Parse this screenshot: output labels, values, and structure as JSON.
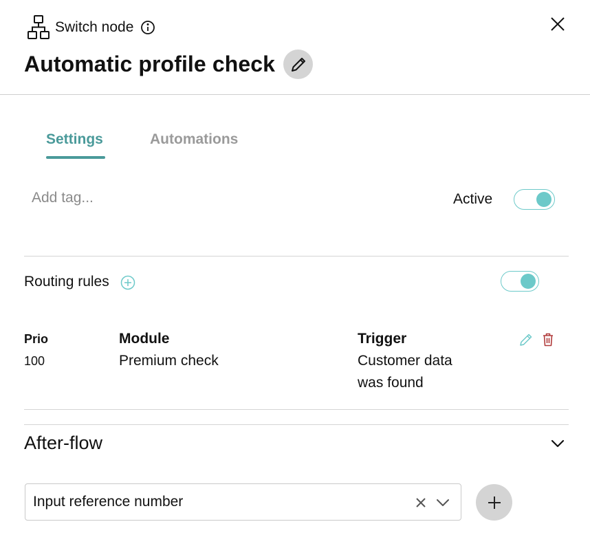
{
  "header": {
    "node_type": "Switch node",
    "title": "Automatic profile check",
    "icons": {
      "node": "network-tree-icon",
      "info": "info-icon",
      "close": "close-icon",
      "edit": "pencil-icon"
    }
  },
  "tabs": [
    {
      "label": "Settings",
      "selected": true
    },
    {
      "label": "Automations",
      "selected": false
    }
  ],
  "tag_input": {
    "placeholder": "Add tag...",
    "value": ""
  },
  "active": {
    "label": "Active",
    "on": true
  },
  "routing_rules": {
    "label": "Routing rules",
    "enabled": true,
    "columns": {
      "prio": "Prio",
      "module": "Module",
      "trigger": "Trigger"
    },
    "rows": [
      {
        "prio": "100",
        "module": "Premium check",
        "trigger_line1": "Customer data",
        "trigger_line2": "was found"
      }
    ]
  },
  "after_flow": {
    "title": "After-flow",
    "expanded": true,
    "selected_value": "Input reference number"
  },
  "colors": {
    "accent": "#4a9a9a",
    "toggle": "#6cc9c9",
    "delete": "#b03a3a",
    "muted_tab": "#9a9a9a"
  }
}
